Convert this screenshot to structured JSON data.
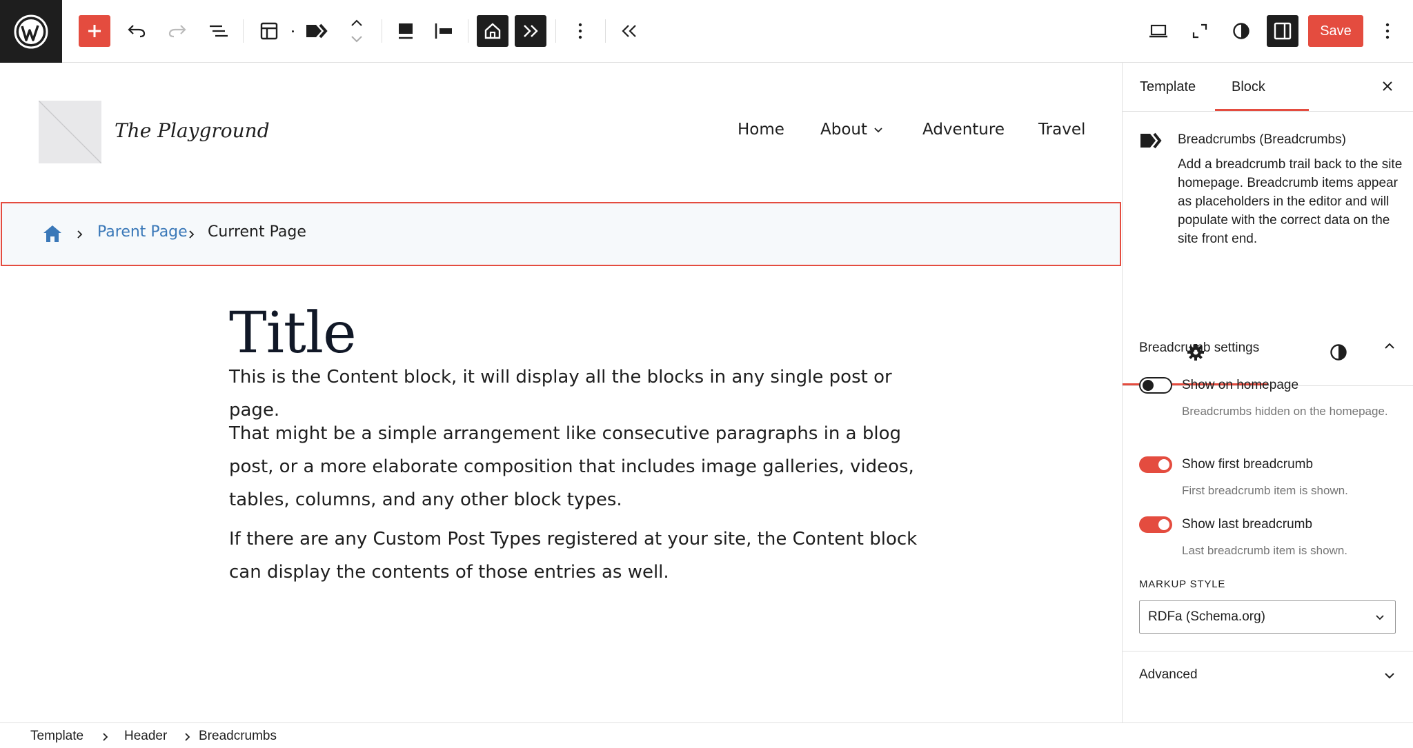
{
  "toolbar": {
    "logo_icon": "wordpress-logo-icon",
    "save_label": "Save",
    "accent": "#e44c3f"
  },
  "site": {
    "title": "The Playground",
    "nav": [
      {
        "label": "Home"
      },
      {
        "label": "About",
        "has_submenu": true
      },
      {
        "label": "Adventure"
      },
      {
        "label": "Travel"
      }
    ]
  },
  "breadcrumb_block": {
    "home_icon": "home-icon",
    "parent": "Parent Page",
    "current": "Current Page",
    "link_color": "#3a78b8"
  },
  "content": {
    "title": "Title",
    "paragraphs": [
      "This is the Content block, it will display all the blocks in any single post or page.",
      "That might be a simple arrangement like consecutive paragraphs in a blog post, or a more elaborate composition that includes image galleries, videos, tables, columns, and any other block types.",
      "If there are any Custom Post Types registered at your site, the Content block can display the contents of those entries as well."
    ]
  },
  "sidebar": {
    "tabs": [
      {
        "label": "Template"
      },
      {
        "label": "Block",
        "active": true
      }
    ],
    "block": {
      "title": "Breadcrumbs (Breadcrumbs)",
      "description": "Add a breadcrumb trail back to the site homepage. Breadcrumb items appear as placeholders in the editor and will populate with the correct data on the site front end."
    },
    "settings_panel": {
      "title": "Breadcrumb settings",
      "toggles": [
        {
          "label": "Show on homepage",
          "help": "Breadcrumbs hidden on the homepage.",
          "on": false
        },
        {
          "label": "Show first breadcrumb",
          "help": "First breadcrumb item is shown.",
          "on": true
        },
        {
          "label": "Show last breadcrumb",
          "help": "Last breadcrumb item is shown.",
          "on": true
        }
      ],
      "markup_label": "MARKUP STYLE",
      "markup_value": "RDFa (Schema.org)"
    },
    "advanced_label": "Advanced"
  },
  "footer_breadcrumb": [
    "Template",
    "Header",
    "Breadcrumbs"
  ]
}
